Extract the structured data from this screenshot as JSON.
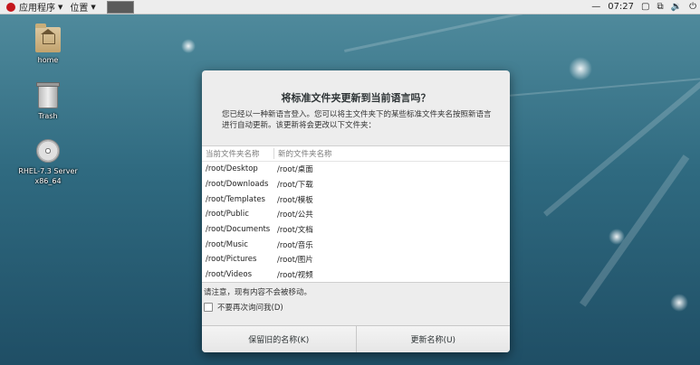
{
  "topbar": {
    "applications_label": "应用程序",
    "places_label": "位置",
    "time": "07:27"
  },
  "desktop": {
    "icons": [
      {
        "label": "home",
        "icon": "home-folder-icon"
      },
      {
        "label": "Trash",
        "icon": "trash-icon"
      },
      {
        "label": "RHEL-7.3 Server x86_64",
        "icon": "disc-icon"
      }
    ]
  },
  "dialog": {
    "title": "将标准文件夹更新到当前语言吗？",
    "description": "您已经以一种新语言登入。您可以将主文件夹下的某些标准文件夹名按照新语言进行自动更新。该更新将会更改以下文件夹：",
    "columns": {
      "current": "当前文件夹名称",
      "new": "新的文件夹名称"
    },
    "rows": [
      {
        "current": "/root/Desktop",
        "new": "/root/桌面"
      },
      {
        "current": "/root/Downloads",
        "new": "/root/下载"
      },
      {
        "current": "/root/Templates",
        "new": "/root/模板"
      },
      {
        "current": "/root/Public",
        "new": "/root/公共"
      },
      {
        "current": "/root/Documents",
        "new": "/root/文档"
      },
      {
        "current": "/root/Music",
        "new": "/root/音乐"
      },
      {
        "current": "/root/Pictures",
        "new": "/root/图片"
      },
      {
        "current": "/root/Videos",
        "new": "/root/视频"
      }
    ],
    "note": "请注意，现有内容不会被移动。",
    "dont_ask_label": "不要再次询问我(D)",
    "keep_button": "保留旧的名称(K)",
    "update_button": "更新名称(U)"
  },
  "colors": {
    "panel": "#ededed",
    "dialog_bg": "#ededed",
    "desktop_bg": "#2f6a80"
  }
}
